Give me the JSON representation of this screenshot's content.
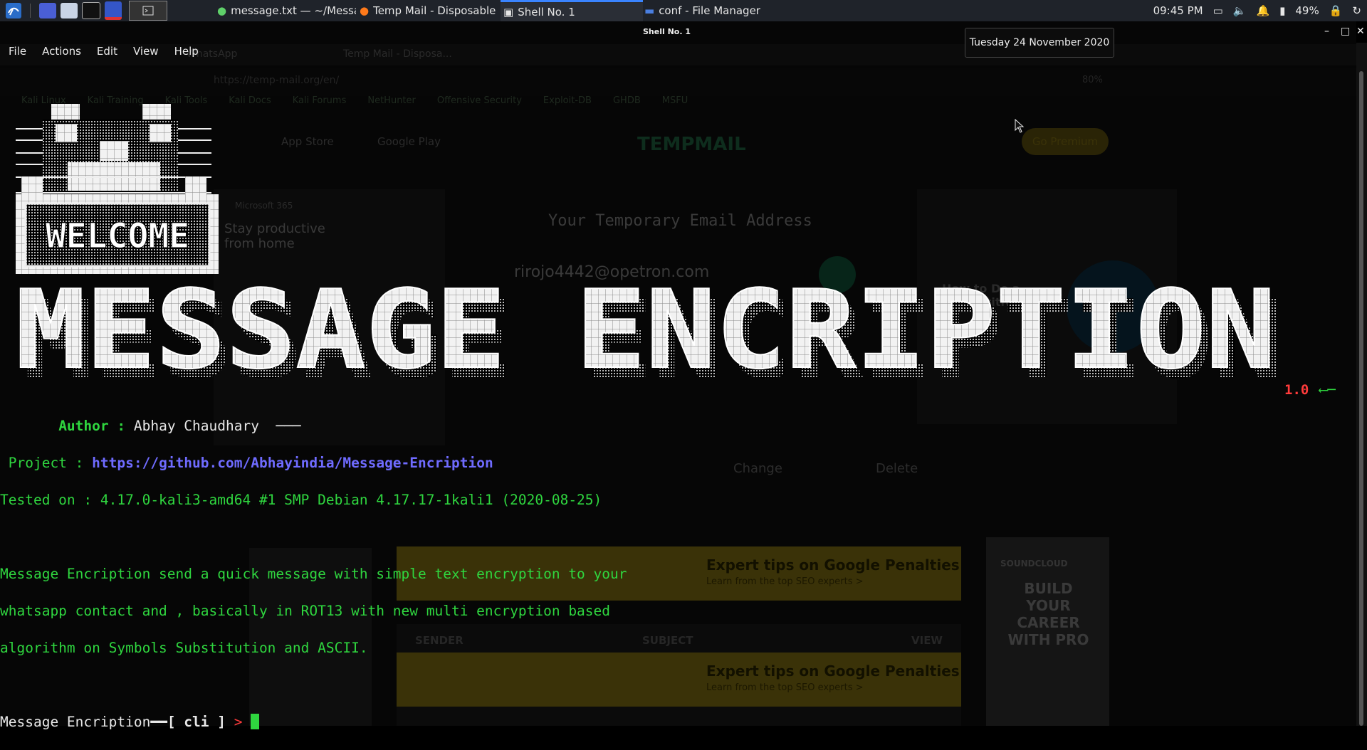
{
  "taskbar": {
    "tasks": [
      {
        "label": "message.txt — ~/Messa..."
      },
      {
        "label": "Temp Mail - Disposable ..."
      },
      {
        "label": "Shell No. 1"
      },
      {
        "label": "conf - File Manager"
      }
    ],
    "time": "09:45 PM",
    "battery": "49%"
  },
  "tooltip": {
    "date": "Tuesday 24 November 2020"
  },
  "terminal": {
    "title": "Shell No. 1",
    "menu": [
      "File",
      "Actions",
      "Edit",
      "View",
      "Help"
    ],
    "banner": {
      "welcome": "WELCOME",
      "title": "MESSAGE ENCRIPTION",
      "version": "1.0"
    },
    "author_label": "Author :",
    "author_value": "Abhay Chaudhary",
    "project_label": "Project :",
    "project_url": "https://github.com/Abhayindia/Message-Encription",
    "tested_on": "Tested on : 4.17.0-kali3-amd64 #1 SMP Debian 4.17.17-1kali1 (2020-08-25)",
    "desc_line1": "Message Encription send a quick message with simple text encryption to your",
    "desc_line2": "whatsapp contact and , basically in ROT13 with new multi encryption based",
    "desc_line3": "algorithm on Symbols Substitution and ASCII.",
    "prompt_name": "Message Encription",
    "prompt_ctx": "[ cli ]",
    "prompt_arrow": ">"
  },
  "background": {
    "tab1": "WhatsApp",
    "tab2": "Temp Mail - Disposa...",
    "url": "https://temp-mail.org/en/",
    "zoom": "80%",
    "bookmarks": [
      "Kali Linux",
      "Kali Training",
      "Kali Tools",
      "Kali Docs",
      "Kali Forums",
      "NetHunter",
      "Offensive Security",
      "Exploit-DB",
      "GHDB",
      "MSFU"
    ],
    "app_store": "App Store",
    "google_play": "Google Play",
    "logo": "TEMPMAIL",
    "premium": "Go Premium",
    "heading": "Your Temporary Email Address",
    "email": "rirojo4442@opetron.com",
    "ad_left_brand": "Microsoft 365",
    "ad_left_title": "Stay productive from home",
    "ad_right_title": "How to Do a Competitive",
    "change": "Change",
    "delete": "Delete",
    "banner_title": "Expert tips on Google Penalties",
    "banner_sub": "Learn from the top SEO experts >",
    "col_sender": "SENDER",
    "col_subject": "SUBJECT",
    "col_view": "VIEW",
    "ad_side_brand": "SOUNDCLOUD",
    "ad_side_text": "BUILD YOUR CAREER WITH PRO"
  },
  "colors": {
    "terminal_green": "#2fd63f",
    "link_blue": "#6f6bff",
    "version_red": "#ff3b3b"
  }
}
